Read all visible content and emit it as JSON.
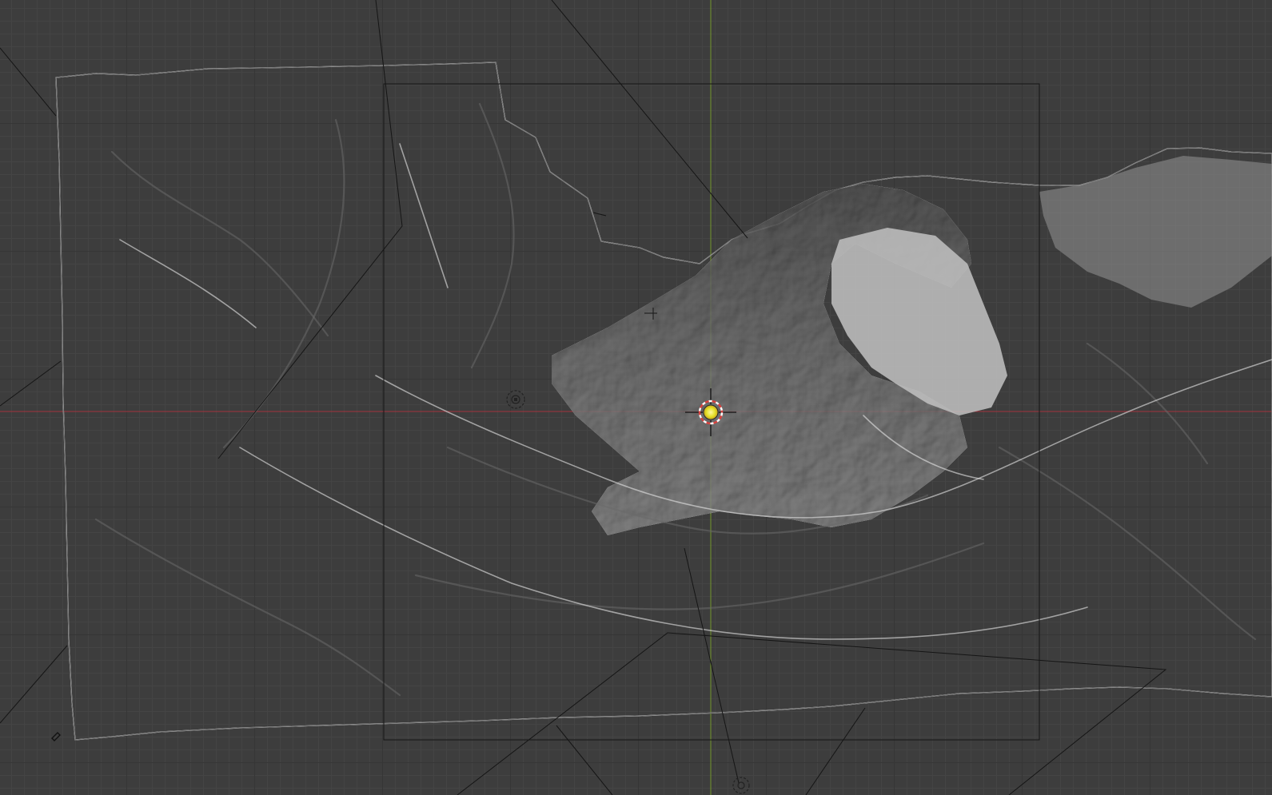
{
  "app": "Blender",
  "editor": "3d-viewport",
  "viewport": {
    "background": "#3d3d3d",
    "grid_minor": "#444444",
    "grid_major": "#363636",
    "axis_x_color": "#b0323d",
    "axis_y_color": "#7ba229"
  },
  "scene": {
    "terrain_mesh": {
      "type": "sculpted terrain relief",
      "material_preview": "solid-grey",
      "color": "#b8b8b8",
      "shadow_color": "#6c6c6c"
    },
    "camera": {
      "frame_color": "#151515"
    },
    "light": {
      "type": "point-light",
      "color": "#e5e22a"
    },
    "cursor_3d": {
      "ring_colors": [
        "#d9413e",
        "#ffffff"
      ],
      "crosshair_color": "#111111"
    },
    "empty_objects": [
      {
        "kind": "light-probe-icon"
      },
      {
        "kind": "empty-icon"
      }
    ]
  }
}
